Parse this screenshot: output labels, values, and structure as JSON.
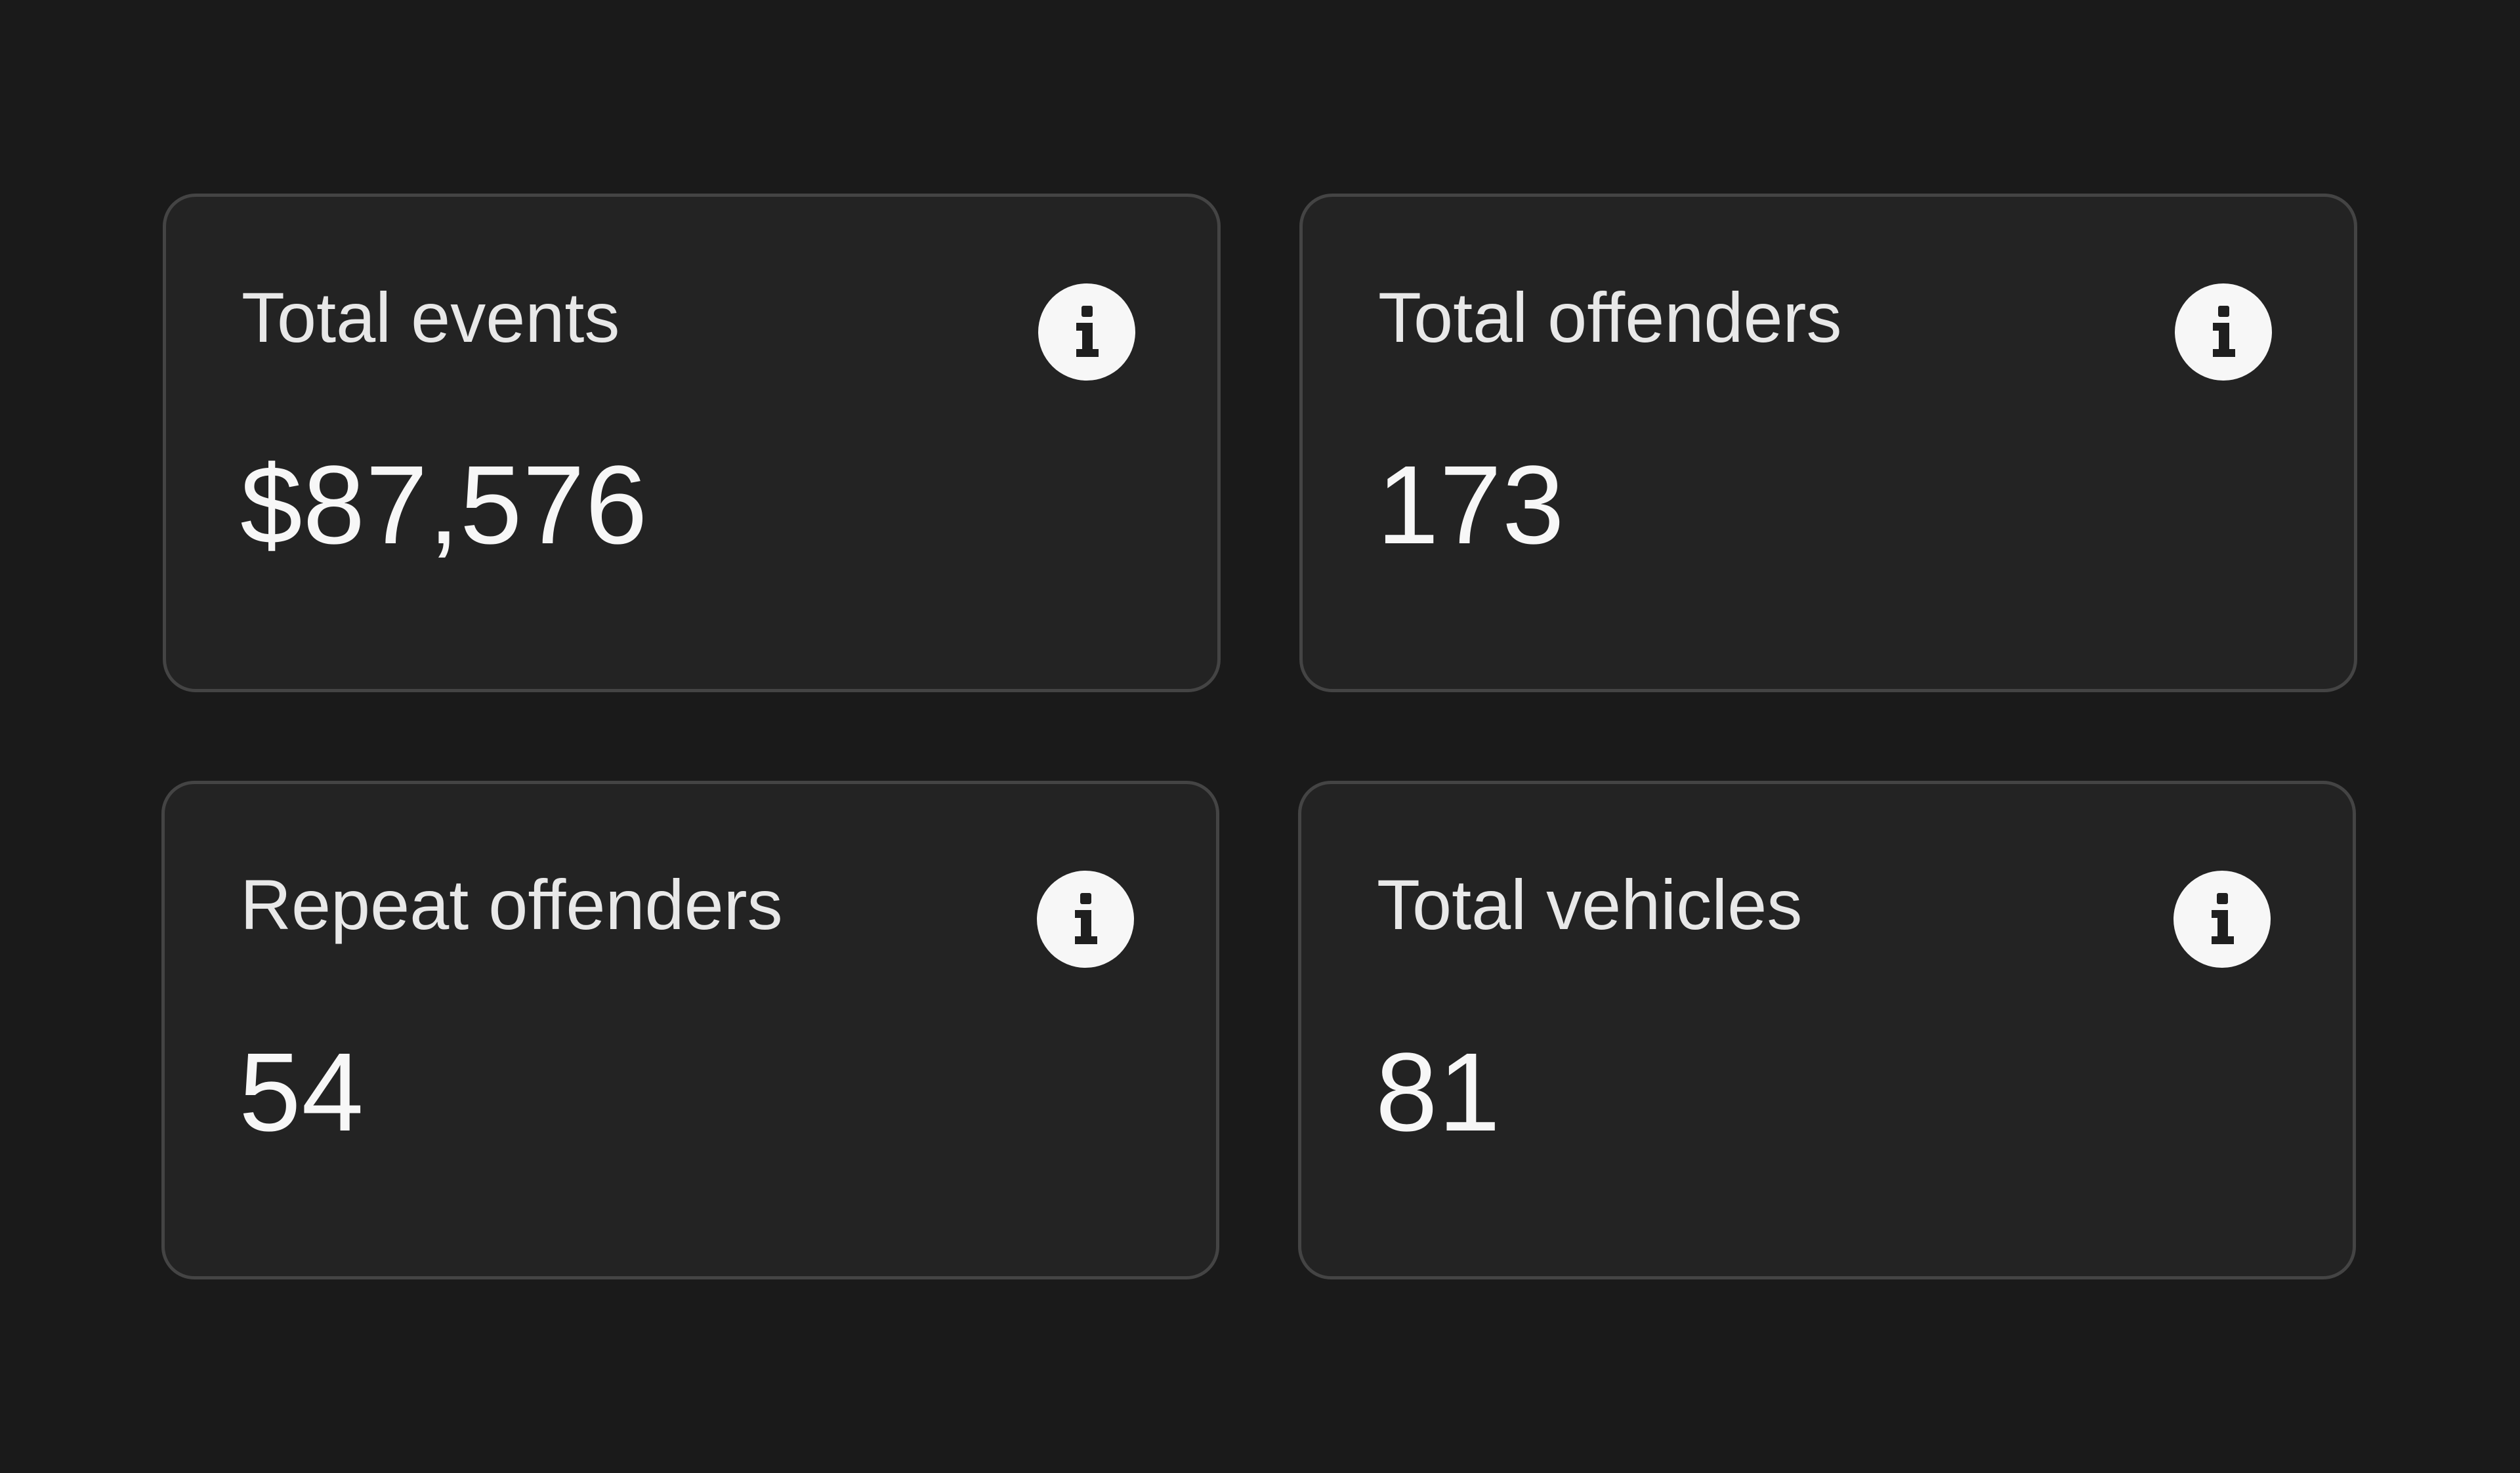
{
  "cards": [
    {
      "label": "Total events",
      "value": "$87,576",
      "icon": "info-icon"
    },
    {
      "label": "Total offenders",
      "value": "173",
      "icon": "info-icon"
    },
    {
      "label": "Repeat offenders",
      "value": "54",
      "icon": "info-icon"
    },
    {
      "label": "Total vehicles",
      "value": "81",
      "icon": "info-icon"
    }
  ],
  "colors": {
    "page_background": "#1a1a1a",
    "card_background": "#232323",
    "card_border": "#444444",
    "text": "#f7f7f7",
    "icon_background": "#f7f7f7",
    "icon_glyph": "#1f1f1f"
  }
}
